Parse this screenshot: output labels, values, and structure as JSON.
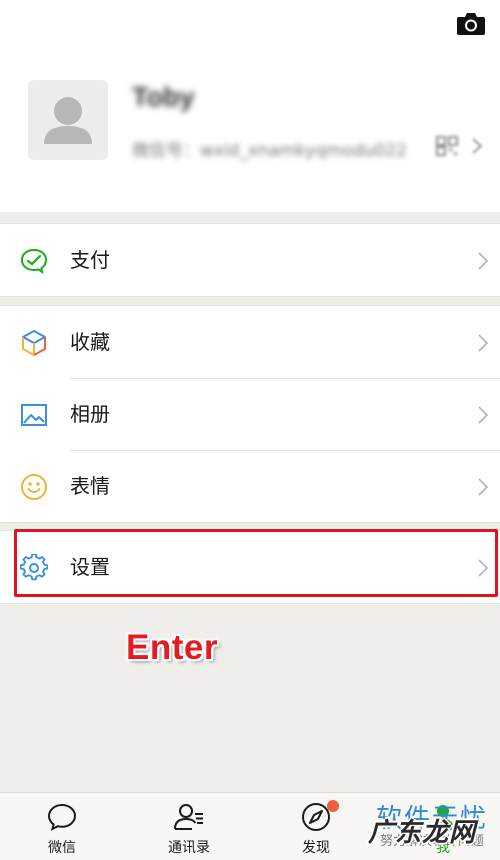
{
  "colors": {
    "accent_green": "#1aad19",
    "highlight_red": "#e0141c",
    "watermark_blue": "#2e8bd4",
    "badge_orange": "#f35d3f"
  },
  "header": {
    "camera_icon": "camera-icon",
    "profile": {
      "name": "Toby",
      "wechat_id": "微信号：wxid_xnamkyqmodu022",
      "qr_icon": "qr-code-icon"
    }
  },
  "menu": {
    "pay": {
      "label": "支付",
      "icon": "wallet-check-icon"
    },
    "favorites": {
      "label": "收藏",
      "icon": "cube-icon"
    },
    "album": {
      "label": "相册",
      "icon": "image-icon"
    },
    "stickers": {
      "label": "表情",
      "icon": "smiley-icon"
    },
    "settings": {
      "label": "设置",
      "icon": "gear-icon"
    }
  },
  "annotation": {
    "text": "Enter"
  },
  "tabbar": {
    "tabs": [
      {
        "label": "微信",
        "icon": "chat-bubble-icon"
      },
      {
        "label": "通讯录",
        "icon": "contacts-icon"
      },
      {
        "label": "发现",
        "icon": "compass-icon"
      },
      {
        "label": "我",
        "icon": "person-icon"
      }
    ]
  },
  "watermark": {
    "title": "软件无忧",
    "subtitle": "努力解决软件问题",
    "logo": "广东龙网"
  }
}
